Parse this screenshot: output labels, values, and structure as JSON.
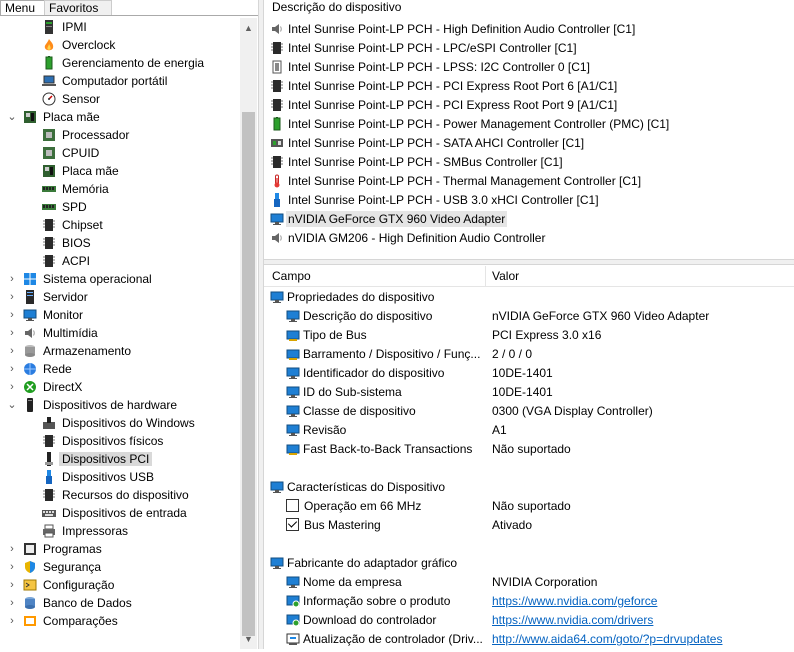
{
  "tabs": [
    {
      "label": "Menu"
    },
    {
      "label": "Favoritos"
    }
  ],
  "tree": [
    {
      "label": "IPMI",
      "icon": "ipmi-icon",
      "depth": 1
    },
    {
      "label": "Overclock",
      "icon": "flame-icon",
      "depth": 1
    },
    {
      "label": "Gerenciamento de energia",
      "icon": "battery-icon",
      "depth": 1
    },
    {
      "label": "Computador portátil",
      "icon": "laptop-icon",
      "depth": 1
    },
    {
      "label": "Sensor",
      "icon": "gauge-icon",
      "depth": 1
    },
    {
      "label": "Placa mãe",
      "icon": "motherboard-icon",
      "depth": 0,
      "expander": "expanded"
    },
    {
      "label": "Processador",
      "icon": "cpu-icon",
      "depth": 1
    },
    {
      "label": "CPUID",
      "icon": "cpu-icon",
      "depth": 1
    },
    {
      "label": "Placa mãe",
      "icon": "motherboard-icon",
      "depth": 1
    },
    {
      "label": "Memória",
      "icon": "ram-icon",
      "depth": 1
    },
    {
      "label": "SPD",
      "icon": "ram-icon",
      "depth": 1
    },
    {
      "label": "Chipset",
      "icon": "chip-icon",
      "depth": 1
    },
    {
      "label": "BIOS",
      "icon": "chip-icon",
      "depth": 1
    },
    {
      "label": "ACPI",
      "icon": "chip-icon",
      "depth": 1
    },
    {
      "label": "Sistema operacional",
      "icon": "windows-icon",
      "depth": 0,
      "expander": "collapsed"
    },
    {
      "label": "Servidor",
      "icon": "server-icon",
      "depth": 0,
      "expander": "collapsed"
    },
    {
      "label": "Monitor",
      "icon": "monitor-icon",
      "depth": 0,
      "expander": "collapsed"
    },
    {
      "label": "Multimídia",
      "icon": "speaker-icon",
      "depth": 0,
      "expander": "collapsed"
    },
    {
      "label": "Armazenamento",
      "icon": "disk-icon",
      "depth": 0,
      "expander": "collapsed"
    },
    {
      "label": "Rede",
      "icon": "network-icon",
      "depth": 0,
      "expander": "collapsed"
    },
    {
      "label": "DirectX",
      "icon": "xbox-icon",
      "depth": 0,
      "expander": "collapsed"
    },
    {
      "label": "Dispositivos de hardware",
      "icon": "device-icon",
      "depth": 0,
      "expander": "expanded"
    },
    {
      "label": "Dispositivos do Windows",
      "icon": "windows-devices-icon",
      "depth": 1
    },
    {
      "label": "Dispositivos físicos",
      "icon": "chip-icon",
      "depth": 1
    },
    {
      "label": "Dispositivos PCI",
      "icon": "pci-icon",
      "depth": 1,
      "selected": true
    },
    {
      "label": "Dispositivos USB",
      "icon": "usb-icon",
      "depth": 1
    },
    {
      "label": "Recursos do dispositivo",
      "icon": "chip-icon",
      "depth": 1
    },
    {
      "label": "Dispositivos de entrada",
      "icon": "keyboard-icon",
      "depth": 1
    },
    {
      "label": "Impressoras",
      "icon": "printer-icon",
      "depth": 1
    },
    {
      "label": "Programas",
      "icon": "programs-icon",
      "depth": 0,
      "expander": "collapsed"
    },
    {
      "label": "Segurança",
      "icon": "shield-icon",
      "depth": 0,
      "expander": "collapsed"
    },
    {
      "label": "Configuração",
      "icon": "config-icon",
      "depth": 0,
      "expander": "collapsed"
    },
    {
      "label": "Banco de Dados",
      "icon": "database-icon",
      "depth": 0,
      "expander": "collapsed"
    },
    {
      "label": "Comparações",
      "icon": "compare-icon",
      "depth": 0,
      "expander": "collapsed"
    }
  ],
  "device_list": {
    "header": "Descrição do dispositivo",
    "items": [
      {
        "label": "Intel Sunrise Point-LP PCH - High Definition Audio Controller [C1]",
        "icon": "speaker-icon"
      },
      {
        "label": "Intel Sunrise Point-LP PCH - LPC/eSPI Controller [C1]",
        "icon": "chip-icon"
      },
      {
        "label": "Intel Sunrise Point-LP PCH - LPSS: I2C Controller 0 [C1]",
        "icon": "chip-outline-icon"
      },
      {
        "label": "Intel Sunrise Point-LP PCH - PCI Express Root Port 6 [A1/C1]",
        "icon": "chip-icon"
      },
      {
        "label": "Intel Sunrise Point-LP PCH - PCI Express Root Port 9 [A1/C1]",
        "icon": "chip-icon"
      },
      {
        "label": "Intel Sunrise Point-LP PCH - Power Management Controller (PMC) [C1]",
        "icon": "battery-icon"
      },
      {
        "label": "Intel Sunrise Point-LP PCH - SATA AHCI Controller [C1]",
        "icon": "sata-icon"
      },
      {
        "label": "Intel Sunrise Point-LP PCH - SMBus Controller [C1]",
        "icon": "chip-icon"
      },
      {
        "label": "Intel Sunrise Point-LP PCH - Thermal Management Controller [C1]",
        "icon": "thermometer-icon"
      },
      {
        "label": "Intel Sunrise Point-LP PCH - USB 3.0 xHCI Controller  [C1]",
        "icon": "usb-icon"
      },
      {
        "label": "nVIDIA GeForce GTX 960 Video Adapter",
        "icon": "monitor-icon",
        "selected": true
      },
      {
        "label": "nVIDIA GM206 - High Definition Audio Controller",
        "icon": "speaker-icon"
      }
    ]
  },
  "columns": {
    "field": "Campo",
    "value": "Valor"
  },
  "properties": [
    {
      "type": "group",
      "field": "Propriedades do dispositivo",
      "icon": "monitor-icon"
    },
    {
      "type": "item",
      "field": "Descrição do dispositivo",
      "value": "nVIDIA GeForce GTX 960 Video Adapter",
      "icon": "monitor-icon"
    },
    {
      "type": "item",
      "field": "Tipo de Bus",
      "value": "PCI Express 3.0 x16",
      "icon": "pci-bus-icon"
    },
    {
      "type": "item",
      "field": "Barramento / Dispositivo / Funç...",
      "value": "2 / 0 / 0",
      "icon": "pci-bus-icon"
    },
    {
      "type": "item",
      "field": "Identificador do dispositivo",
      "value": "10DE-1401",
      "icon": "monitor-icon"
    },
    {
      "type": "item",
      "field": "ID do Sub-sistema",
      "value": "10DE-1401",
      "icon": "monitor-icon"
    },
    {
      "type": "item",
      "field": "Classe de dispositivo",
      "value": "0300 (VGA Display Controller)",
      "icon": "monitor-icon"
    },
    {
      "type": "item",
      "field": "Revisão",
      "value": "A1",
      "icon": "monitor-icon"
    },
    {
      "type": "item",
      "field": "Fast Back-to-Back Transactions",
      "value": "Não suportado",
      "icon": "pci-bus-icon"
    },
    {
      "type": "spacer"
    },
    {
      "type": "group",
      "field": "Características do Dispositivo",
      "icon": "monitor-icon"
    },
    {
      "type": "check",
      "field": "Operação em 66 MHz",
      "value": "Não suportado",
      "checked": false
    },
    {
      "type": "check",
      "field": "Bus Mastering",
      "value": "Ativado",
      "checked": true
    },
    {
      "type": "spacer"
    },
    {
      "type": "group",
      "field": "Fabricante do adaptador gráfico",
      "icon": "monitor-icon"
    },
    {
      "type": "item",
      "field": "Nome da empresa",
      "value": "NVIDIA Corporation",
      "icon": "monitor-icon"
    },
    {
      "type": "item",
      "field": "Informação sobre o produto",
      "value": "https://www.nvidia.com/geforce",
      "icon": "globe-icon",
      "link": true
    },
    {
      "type": "item",
      "field": "Download do controlador",
      "value": "https://www.nvidia.com/drivers",
      "icon": "globe-icon",
      "link": true
    },
    {
      "type": "item",
      "field": "Atualização de controlador (Driv...",
      "value": "http://www.aida64.com/goto/?p=drvupdates",
      "icon": "update-icon",
      "link": true
    }
  ],
  "colors": {
    "selection": "#d9d9d9",
    "link": "#0563c1",
    "panel_bg": "#f0f0f0"
  }
}
